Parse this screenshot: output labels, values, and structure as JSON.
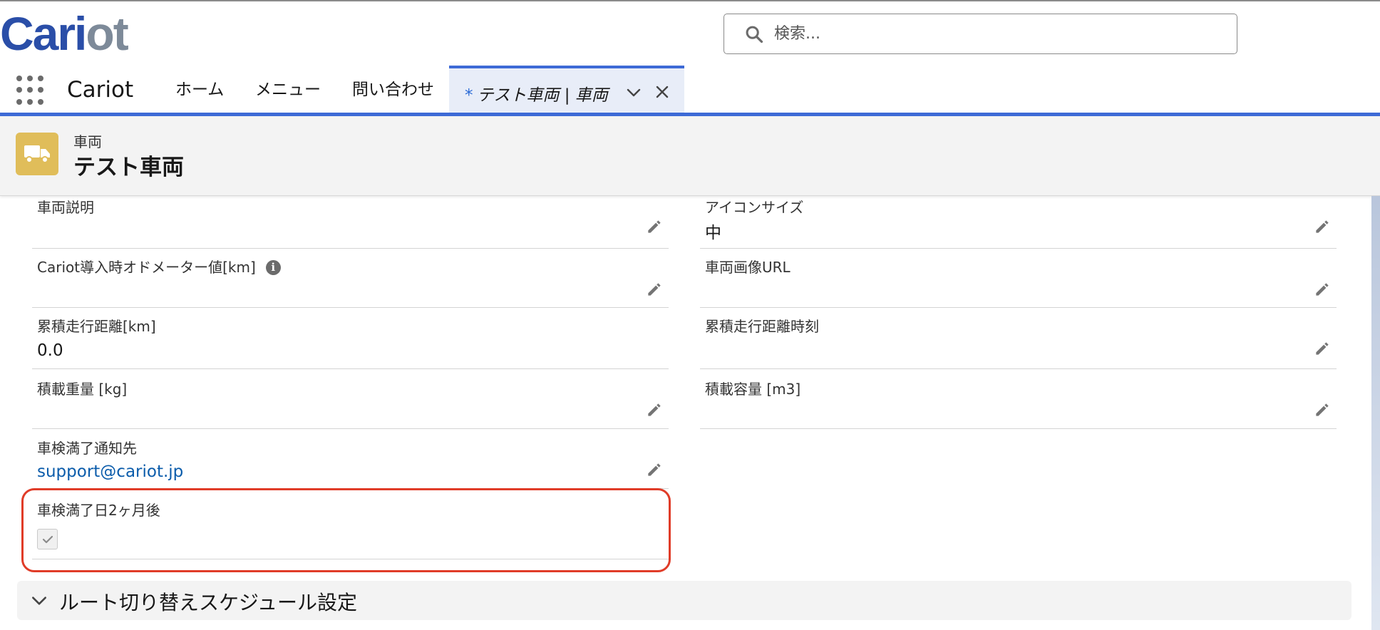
{
  "app": {
    "logo": {
      "part1": "Ca",
      "part2": "ri",
      "part3": "ot"
    },
    "name": "Cariot"
  },
  "search": {
    "placeholder": "検索..."
  },
  "nav": {
    "items": [
      {
        "label": "ホーム"
      },
      {
        "label": "メニュー"
      },
      {
        "label": "問い合わせ"
      }
    ],
    "active_tab": {
      "marker": "*",
      "label": "テスト車両 | 車両"
    }
  },
  "record": {
    "object_type": "車両",
    "title": "テスト車両",
    "icon": "truck-icon",
    "icon_color": "#e0bd5a"
  },
  "fields": {
    "left": [
      {
        "label": "車両説明",
        "value": ""
      },
      {
        "label": "Cariot導入時オドメーター値[km]",
        "value": "",
        "info": "i"
      },
      {
        "label": "累積走行距離[km]",
        "value": "0.0"
      },
      {
        "label": "積載重量 [kg]",
        "value": ""
      },
      {
        "label": "車検満了通知先",
        "value": "support@cariot.jp"
      },
      {
        "label": "車検満了日2ヶ月後",
        "value": "",
        "checked": true
      }
    ],
    "right": [
      {
        "label": "アイコンサイズ",
        "value": "中"
      },
      {
        "label": "車両画像URL",
        "value": ""
      },
      {
        "label": "累積走行距離時刻",
        "value": ""
      },
      {
        "label": "積載容量 [m3]",
        "value": ""
      }
    ]
  },
  "section": {
    "title": "ルート切り替えスケジュール設定"
  },
  "colors": {
    "accent": "#3d6ad6",
    "link": "#0b5cab",
    "highlight": "#e03c28"
  }
}
